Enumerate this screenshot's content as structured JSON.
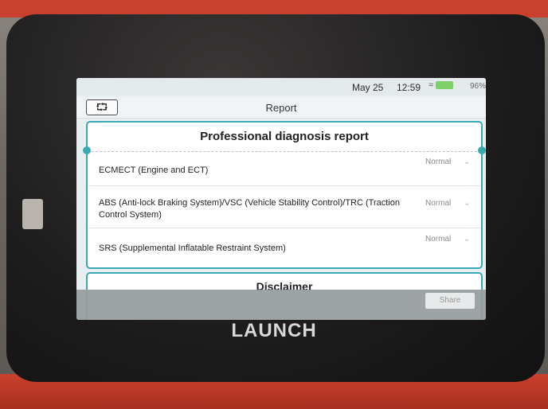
{
  "device": {
    "brand": "LAUNCH"
  },
  "status_bar": {
    "date": "May 25",
    "time": "12:59",
    "battery": "96%"
  },
  "title_bar": {
    "back_icon": "back-icon",
    "title": "Report"
  },
  "report": {
    "heading": "Professional diagnosis report",
    "systems": [
      {
        "name": "ECMECT (Engine and ECT)",
        "status": "Normal"
      },
      {
        "name": "ABS (Anti-lock Braking System)/VSC (Vehicle Stability Control)/TRC (Traction Control System)",
        "status": "Normal"
      },
      {
        "name": "SRS (Supplemental Inflatable Restraint System)",
        "status": "Normal"
      }
    ]
  },
  "disclaimer": {
    "heading": "Disclaimer"
  },
  "bottom_bar": {
    "share_label": "Share"
  },
  "colors": {
    "accent": "#39a9b4",
    "device_red": "#c9402e"
  }
}
